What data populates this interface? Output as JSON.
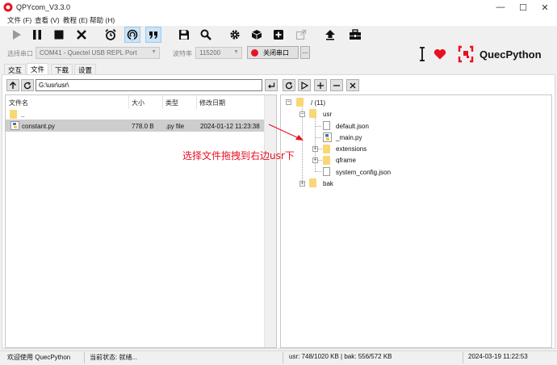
{
  "window": {
    "title": "QPYcom_V3.3.0",
    "minimize": "—",
    "maximize": "☐",
    "close": "✕"
  },
  "menu": [
    "文件 (F)",
    "查看 (V)",
    "教程 (E)",
    "帮助 (H)"
  ],
  "toolbar": {
    "icons": [
      "play-icon",
      "pause-icon",
      "stop-icon",
      "close-icon",
      "alarm-clock-icon",
      "radar-icon",
      "quote-icon",
      "save-icon",
      "search-icon",
      "gear-icon",
      "cube-icon",
      "plus-square-icon",
      "share-icon",
      "upload-icon",
      "toolbox-icon"
    ]
  },
  "serial": {
    "port_label": "选择串口",
    "port_value": "COM41 - Quectel USB REPL Port",
    "baud_label": "波特率",
    "baud_value": "115200",
    "open_button": "关闭串口",
    "more_button": "...",
    "brand": "QuecPython"
  },
  "tabs": [
    "交互",
    "文件",
    "下载",
    "设置"
  ],
  "active_tab": "文件",
  "local": {
    "path": "G:\\usr\\usr\\",
    "columns": [
      "文件名",
      "大小",
      "类型",
      "修改日期"
    ],
    "rows": [
      {
        "name": "..",
        "size": "",
        "type": "",
        "date": ""
      },
      {
        "name": "constant.py",
        "size": "778.0 B",
        "type": ".py file",
        "date": "2024-01-12 11:23:38"
      }
    ]
  },
  "device": {
    "root": "/ (11)",
    "usr": "usr",
    "usr_children": [
      "default.json",
      "_main.py",
      "extensions",
      "qframe",
      "system_config.json"
    ],
    "bak": "bak"
  },
  "annotation": "选择文件拖拽到右边usr下",
  "status": {
    "welcome": "欢迎使用 QuecPython",
    "state": "当前状态: 就绪...",
    "storage": "usr: 748/1020 KB | bak: 556/572 KB",
    "datetime": "2024-03-19 11:22:53"
  },
  "colors": {
    "accent": "#e81123",
    "selection": "#cdcdcd",
    "folder": "#f8d775"
  }
}
